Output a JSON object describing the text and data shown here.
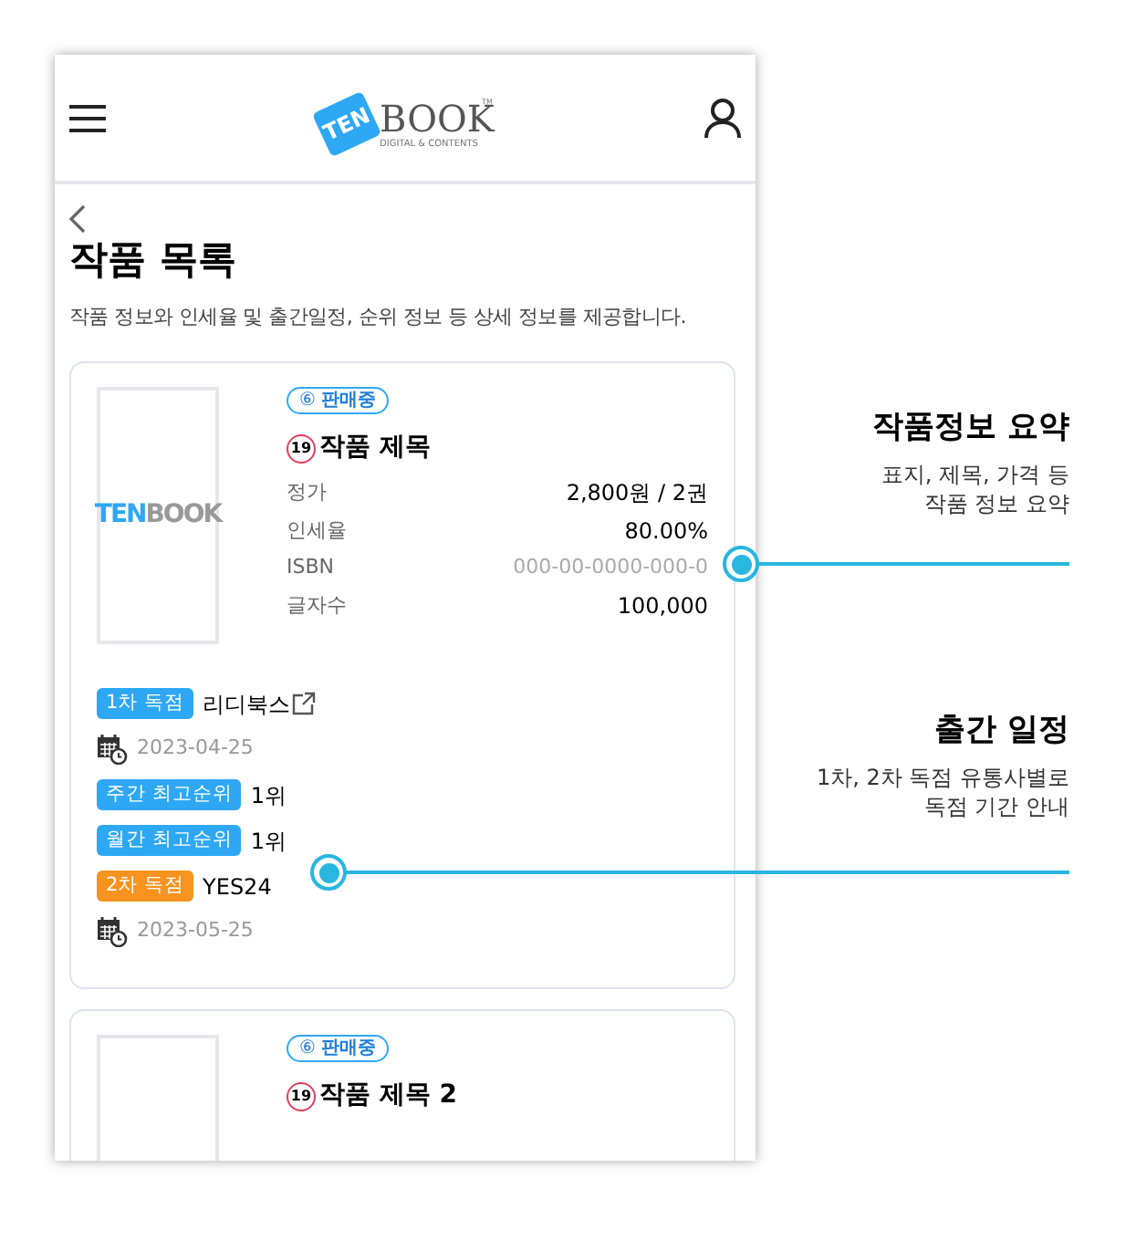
{
  "header": {
    "logo": {
      "mark": "TEN",
      "word": "BOOK",
      "tagline": "DIGITAL & CONTENTS",
      "tm": "TM"
    }
  },
  "page": {
    "title": "작품 목록",
    "description": "작품 정보와 인세율 및 출간일정, 순위 정보 등 상세 정보를 제공합니다."
  },
  "works": [
    {
      "cover": {
        "mark": "TEN",
        "word": "BOOK"
      },
      "status_icon": "⑥",
      "status": "판매중",
      "age_rating": "19",
      "title": "작품 제목",
      "details": [
        {
          "label": "정가",
          "value": "2,800원 / 2권",
          "muted": false
        },
        {
          "label": "인세율",
          "value": "80.00%",
          "muted": false
        },
        {
          "label": "ISBN",
          "value": "000-00-0000-000-0",
          "muted": true
        },
        {
          "label": "글자수",
          "value": "100,000",
          "muted": false
        }
      ],
      "schedule": [
        {
          "kind": "tag",
          "tag": "1차 독점",
          "color": "#2ea8f5",
          "value": "리디북스",
          "external_link": true
        },
        {
          "kind": "date",
          "date": "2023-04-25"
        },
        {
          "kind": "tag",
          "tag": "주간 최고순위",
          "color": "#2ea8f5",
          "value": "1위",
          "external_link": false
        },
        {
          "kind": "tag",
          "tag": "월간 최고순위",
          "color": "#2ea8f5",
          "value": "1위",
          "external_link": false
        },
        {
          "kind": "tag",
          "tag": "2차 독점",
          "color": "#f7931e",
          "value": "YES24",
          "external_link": false
        },
        {
          "kind": "date",
          "date": "2023-05-25"
        }
      ]
    },
    {
      "status_icon": "⑥",
      "status": "판매중",
      "age_rating": "19",
      "title": "작품 제목 2"
    }
  ],
  "callouts": [
    {
      "title": "작품정보 요약",
      "lines": [
        "표지, 제목, 가격 등",
        "작품 정보 요약"
      ]
    },
    {
      "title": "출간 일정",
      "lines": [
        "1차, 2차 독점 유통사별로",
        "독점 기간 안내"
      ]
    }
  ]
}
